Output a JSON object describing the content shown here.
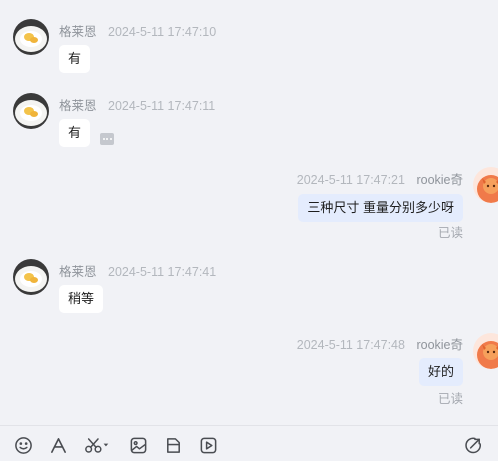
{
  "messages": [
    {
      "direction": "in",
      "sender": "格莱恩",
      "time": "2024-5-11 17:47:10",
      "text": "有"
    },
    {
      "direction": "in",
      "sender": "格莱恩",
      "time": "2024-5-11 17:47:11",
      "text": "有"
    },
    {
      "direction": "out",
      "sender": "rookie奇",
      "time": "2024-5-11 17:47:21",
      "text": "三种尺寸 重量分别多少呀",
      "status": "已读"
    },
    {
      "direction": "in",
      "sender": "格莱恩",
      "time": "2024-5-11 17:47:41",
      "text": "稍等"
    },
    {
      "direction": "out",
      "sender": "rookie奇",
      "time": "2024-5-11 17:47:48",
      "text": "好的",
      "status": "已读"
    }
  ],
  "toolbar": {
    "icons": [
      "emoji-icon",
      "font-icon",
      "scissors-icon",
      "image-icon",
      "file-icon",
      "video-icon",
      "send-icon"
    ]
  },
  "colors": {
    "background": "#f1f2f6",
    "incoming_bubble": "#ffffff",
    "outgoing_bubble": "#e4ecfd",
    "meta_text": "#a9adb4"
  }
}
